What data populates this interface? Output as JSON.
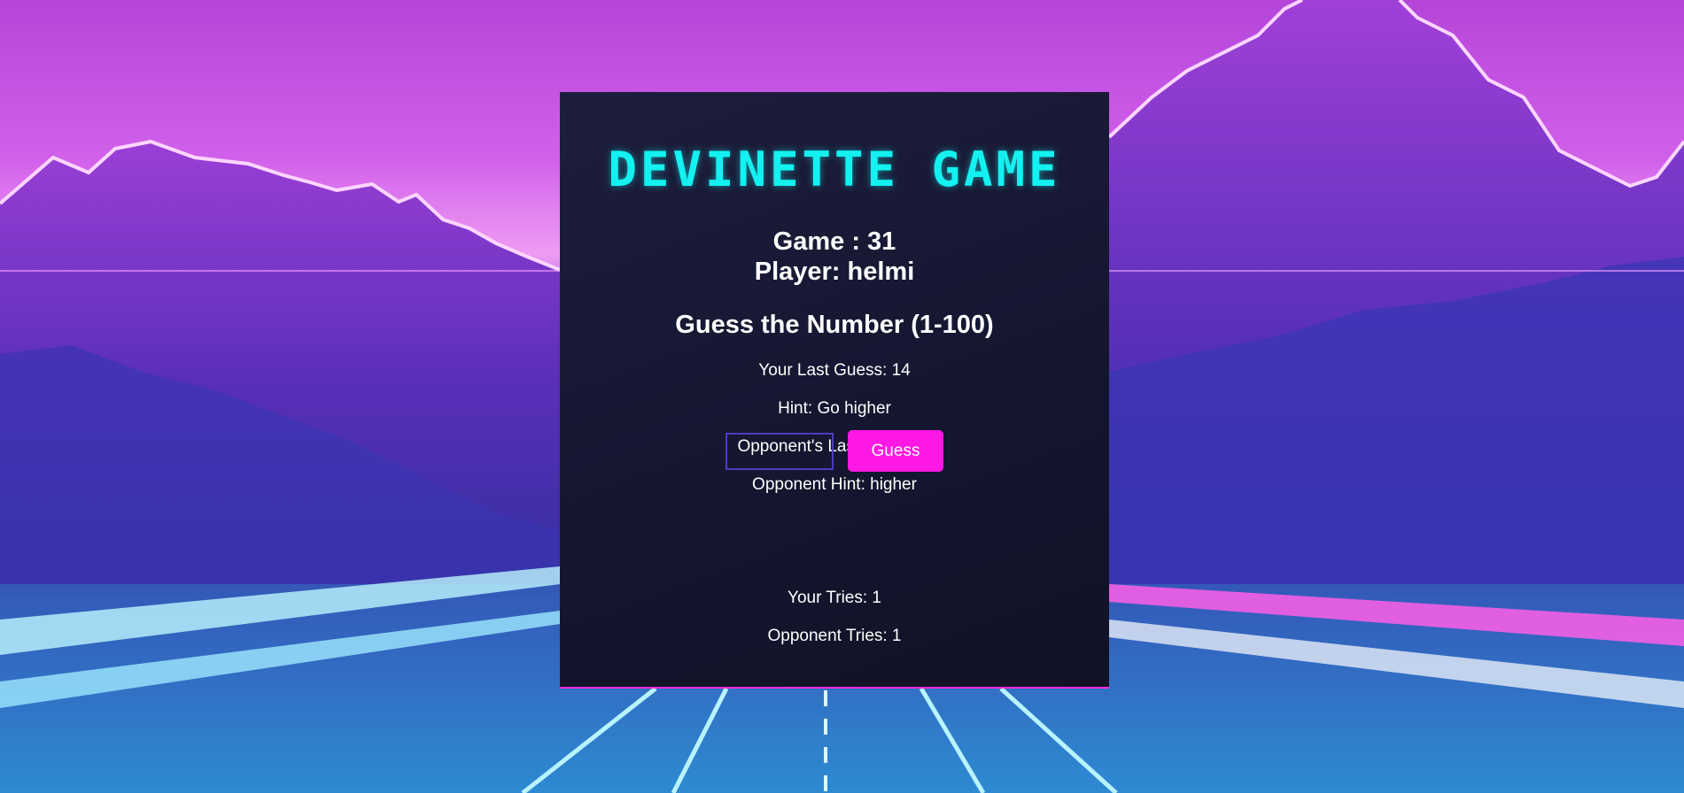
{
  "game": {
    "title": "DEVINETTE GAME",
    "game_line": "Game : 31",
    "player_line": "Player: helmi",
    "subtitle": "Guess the Number (1-100)",
    "last_guess": "Your Last Guess: 14",
    "hint": "Hint: Go higher",
    "opponent_last_guess": "Opponent's Last Guess: 1",
    "opponent_hint": "Opponent Hint: higher",
    "input_value": "",
    "guess_button_label": "Guess",
    "your_tries": "Your Tries: 1",
    "opponent_tries": "Opponent Tries: 1"
  },
  "colors": {
    "title_accent": "#14f1f1",
    "button": "#ff17e4",
    "panel": "#161730",
    "input_border": "#4c3cc0"
  }
}
